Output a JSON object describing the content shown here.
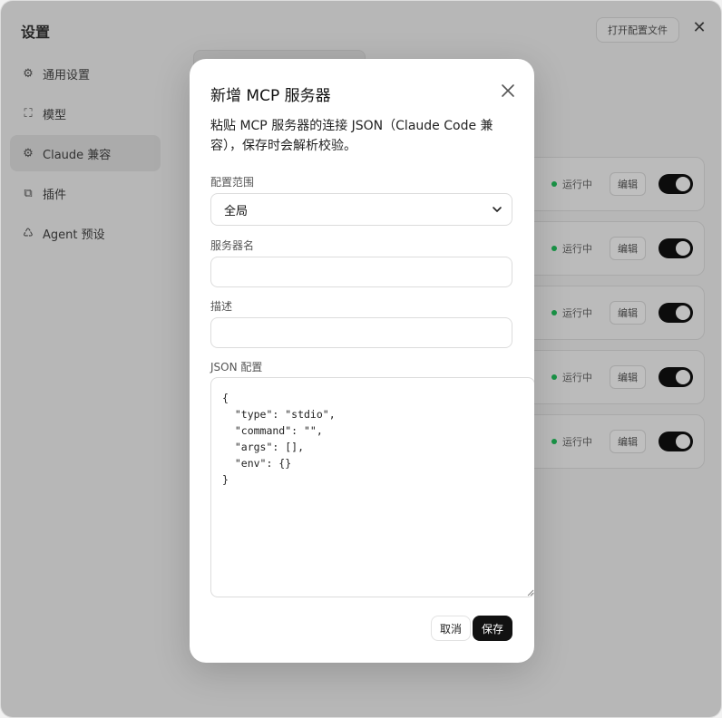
{
  "background": {
    "window_title": "设置",
    "open_config_label": "打开配置文件",
    "close_glyph": "✕",
    "sidebar": {
      "items": [
        {
          "label": "通用设置",
          "icon": "gear-icon",
          "glyph": "⚙",
          "active": false
        },
        {
          "label": "模型",
          "icon": "model-icon",
          "glyph": "⛶",
          "active": false
        },
        {
          "label": "Claude 兼容",
          "icon": "gear-icon",
          "glyph": "⚙",
          "active": true
        },
        {
          "label": "插件",
          "icon": "plugin-icon",
          "glyph": "⧉",
          "active": false
        },
        {
          "label": "Agent 预设",
          "icon": "recycle-icon",
          "glyph": "♺",
          "active": false
        }
      ]
    },
    "servers": [
      {
        "status": "运行中",
        "edit_label": "编辑",
        "enabled": true
      },
      {
        "status": "运行中",
        "edit_label": "编辑",
        "enabled": true
      },
      {
        "status": "运行中",
        "edit_label": "编辑",
        "enabled": true
      },
      {
        "status": "运行中",
        "edit_label": "编辑",
        "enabled": true
      },
      {
        "status": "运行中",
        "edit_label": "编辑",
        "enabled": true
      }
    ]
  },
  "modal": {
    "title": "新增 MCP 服务器",
    "description": "粘贴 MCP 服务器的连接 JSON（Claude Code 兼容），保存时会解析校验。",
    "scope": {
      "label": "配置范围",
      "value": "全局"
    },
    "server_name": {
      "label": "服务器名",
      "value": "",
      "placeholder": ""
    },
    "desc_field": {
      "label": "描述",
      "value": "",
      "placeholder": ""
    },
    "json_config": {
      "label": "JSON 配置",
      "value": "{\n  \"type\": \"stdio\",\n  \"command\": \"\",\n  \"args\": [],\n  \"env\": {}\n}"
    },
    "cancel_label": "取消",
    "save_label": "保存"
  },
  "colors": {
    "primary_button": "#111111",
    "overlay": "rgba(0,0,0,0.25)",
    "status_dot": "#22c55e"
  }
}
